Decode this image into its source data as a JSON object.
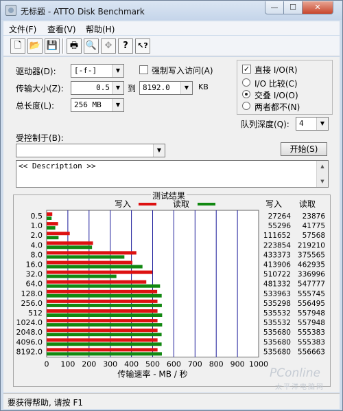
{
  "window": {
    "title": "无标题 - ATTO Disk Benchmark",
    "minimize": "—",
    "maximize": "☐",
    "close": "✕"
  },
  "menu": [
    "文件(F)",
    "查看(V)",
    "帮助(H)"
  ],
  "toolbar": [
    {
      "icon": "new-document-icon",
      "glyph": "🗋"
    },
    {
      "icon": "open-folder-icon",
      "glyph": "📂"
    },
    {
      "icon": "save-icon",
      "glyph": "💾"
    },
    {
      "icon": "print-icon",
      "glyph": "🖶"
    },
    {
      "icon": "print-preview-icon",
      "glyph": "🔍"
    },
    {
      "icon": "move-icon",
      "glyph": "✥"
    },
    {
      "icon": "help-icon",
      "glyph": "?"
    },
    {
      "icon": "context-help-icon",
      "glyph": "↖?"
    }
  ],
  "settings": {
    "drive_label": "驱动器(D):",
    "drive_value": "[-f-]",
    "force_write_label": "强制写入访问(A)",
    "transfer_label": "传输大小(Z):",
    "transfer_from": "0.5",
    "transfer_to_label": "到",
    "transfer_to": "8192.0",
    "transfer_unit": "KB",
    "length_label": "总长度(L):",
    "length_value": "256 MB",
    "direct_io_label": "直接 I/O(R)",
    "io_compare_label": "I/O 比较(C)",
    "io_overlap_label": "交叠 I/O(O)",
    "io_neither_label": "两者都不(N)",
    "queue_label": "队列深度(Q):",
    "queue_value": "4",
    "controlled_label": "受控制于(B):",
    "controlled_value": "",
    "start_label": "开始(S)",
    "description": "<< Description >>"
  },
  "results": {
    "title": "测试结果",
    "legend_write": "写入",
    "legend_read": "读取",
    "col_write": "写入",
    "col_read": "读取",
    "write_color": "#dd1111",
    "read_color": "#118811"
  },
  "chart_data": {
    "type": "bar",
    "orientation": "horizontal",
    "categories": [
      "0.5",
      "1.0",
      "2.0",
      "4.0",
      "8.0",
      "16.0",
      "32.0",
      "64.0",
      "128.0",
      "256.0",
      "512",
      "1024.0",
      "2048.0",
      "4096.0",
      "8192.0"
    ],
    "series": [
      {
        "name": "写入",
        "values": [
          27264,
          55296,
          111652,
          223854,
          433373,
          413906,
          510722,
          481332,
          533963,
          535298,
          535532,
          535532,
          535680,
          535680,
          535680
        ]
      },
      {
        "name": "读取",
        "values": [
          23876,
          41775,
          57568,
          219210,
          375565,
          462935,
          336996,
          547777,
          555745,
          556495,
          557948,
          557948,
          555383,
          555383,
          556663
        ]
      }
    ],
    "xlabel": "传输速率 - MB / 秒",
    "xticks": [
      "0",
      "100",
      "200",
      "300",
      "400",
      "500",
      "600",
      "700",
      "800",
      "900",
      "1000"
    ],
    "xlim": [
      0,
      1000
    ],
    "grid": true
  },
  "status": "要获得帮助, 请按 F1",
  "watermark": "PConline",
  "watermark_sub": "太平洋电脑网"
}
